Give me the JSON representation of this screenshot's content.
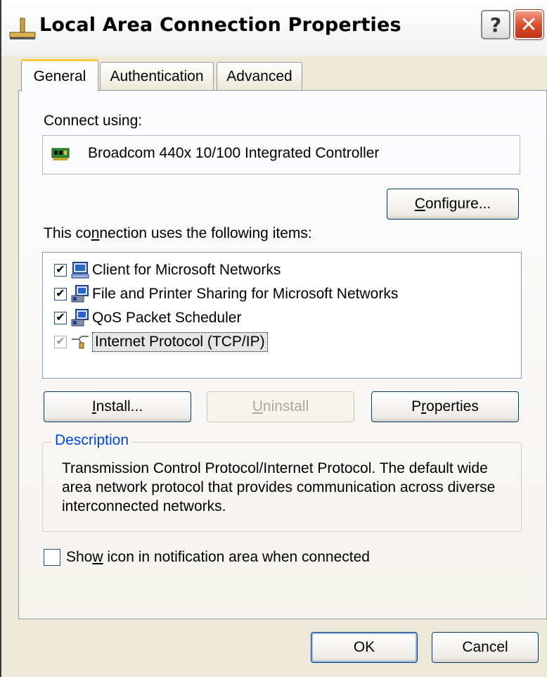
{
  "window": {
    "title": "Local Area Connection Properties",
    "help_label": "?",
    "close_label": "✕"
  },
  "tabs": [
    {
      "label": "General",
      "active": true
    },
    {
      "label": "Authentication",
      "active": false
    },
    {
      "label": "Advanced",
      "active": false
    }
  ],
  "general": {
    "connect_using_label": "Connect using:",
    "adapter_name": "Broadcom 440x 10/100 Integrated Controller",
    "configure_prefix": "C",
    "configure_rest": "onfigure...",
    "items_label_pre": "This co",
    "items_label_u": "n",
    "items_label_post": "nection uses the following items:",
    "items": [
      {
        "label": "Client for Microsoft Networks",
        "checked": true,
        "icon": "network-client-icon"
      },
      {
        "label": "File and Printer Sharing for Microsoft Networks",
        "checked": true,
        "icon": "network-service-icon"
      },
      {
        "label": "QoS Packet Scheduler",
        "checked": true,
        "icon": "network-service-icon"
      },
      {
        "label": "Internet Protocol (TCP/IP)",
        "checked": true,
        "icon": "network-protocol-icon",
        "selected": true
      }
    ],
    "install_u": "I",
    "install_rest": "nstall...",
    "uninstall_u": "U",
    "uninstall_rest": "ninstall",
    "properties_pre": "P",
    "properties_u": "r",
    "properties_post": "operties",
    "description_title": "Description",
    "description_text": "Transmission Control Protocol/Internet Protocol. The default wide area network protocol that provides communication across diverse interconnected networks.",
    "notify_pre": "Sho",
    "notify_u": "w",
    "notify_post": " icon in notification area when connected",
    "notify_checked": false
  },
  "footer": {
    "ok_label": "OK",
    "cancel_label": "Cancel"
  }
}
